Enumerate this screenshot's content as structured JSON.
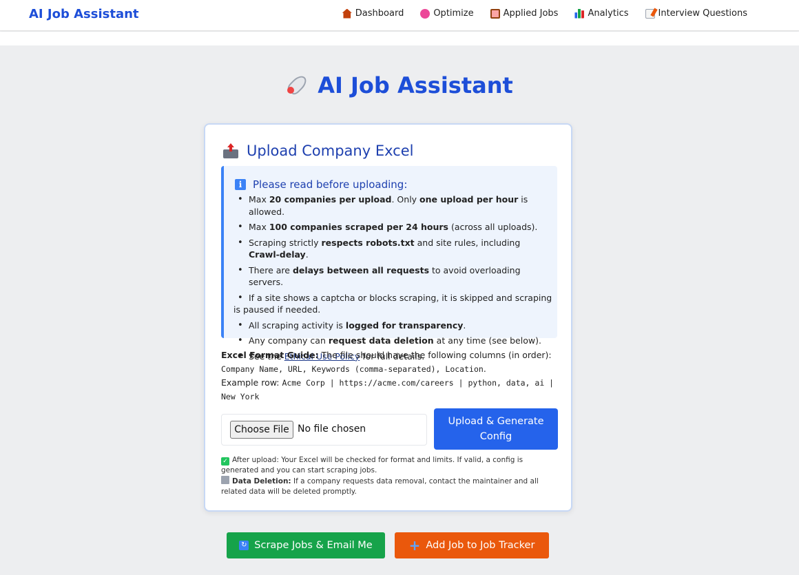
{
  "nav": {
    "brand": "AI Job Assistant",
    "links": [
      {
        "label": "Dashboard",
        "icon": "house-icon"
      },
      {
        "label": "Optimize",
        "icon": "brain-icon"
      },
      {
        "label": "Applied Jobs",
        "icon": "clipboard-icon"
      },
      {
        "label": "Analytics",
        "icon": "bar-chart-icon"
      },
      {
        "label": "Interview Questions",
        "icon": "memo-icon"
      }
    ]
  },
  "hero": {
    "title": "AI Job Assistant",
    "icon": "rocket-icon"
  },
  "upload_card": {
    "title": "Upload Company Excel",
    "icon": "outbox-tray-icon",
    "notice": {
      "heading": "Please read before uploading:",
      "items": [
        {
          "pre": "Max ",
          "b1": "20 companies per upload",
          "mid": ". Only ",
          "b2": "one upload per hour",
          "post": " is allowed."
        },
        {
          "pre": "Max ",
          "b1": "100 companies scraped per 24 hours",
          "post": " (across all uploads)."
        },
        {
          "pre": "Scraping strictly ",
          "b1": "respects robots.txt",
          "mid": " and site rules, including ",
          "b2": "Crawl-delay",
          "post": "."
        },
        {
          "pre": "There are ",
          "b1": "delays between all requests",
          "post": " to avoid overloading servers."
        },
        {
          "pre": "If a site shows a captcha or blocks scraping, it is skipped and scraping is paused if needed."
        },
        {
          "pre": "All scraping activity is ",
          "b1": "logged for transparency",
          "post": "."
        },
        {
          "pre": "Any company can ",
          "b1": "request data deletion",
          "post": " at any time (see below)."
        },
        {
          "pre": "See the ",
          "link": "Ethical Use Policy",
          "post": " for full details."
        }
      ]
    },
    "guide": {
      "label": "Excel Format Guide:",
      "text": " The file should have the following columns (in order):",
      "columns": "Company Name, URL, Keywords (comma-separated), Location",
      "columns_end": ".",
      "example_label": "Example row: ",
      "example_value": "Acme Corp | https://acme.com/careers | python, data, ai | New York"
    },
    "file_input": {
      "button": "Choose File",
      "status": "No file chosen"
    },
    "upload_button": "Upload & Generate Config",
    "notes": {
      "after_upload": "After upload: Your Excel will be checked for format and limits. If valid, a config is generated and you can start scraping jobs.",
      "deletion_label": "Data Deletion:",
      "deletion_text": " If a company requests data removal, contact the maintainer and all related data will be deleted promptly."
    }
  },
  "actions": {
    "scrape": "Scrape Jobs & Email Me",
    "add_job": "Add Job to Job Tracker"
  },
  "colors": {
    "brand": "#1d4ed8",
    "primary_button": "#2563eb",
    "scrape_button": "#16a34a",
    "add_job_button": "#ea580c",
    "notice_bg": "#eef4fd"
  }
}
